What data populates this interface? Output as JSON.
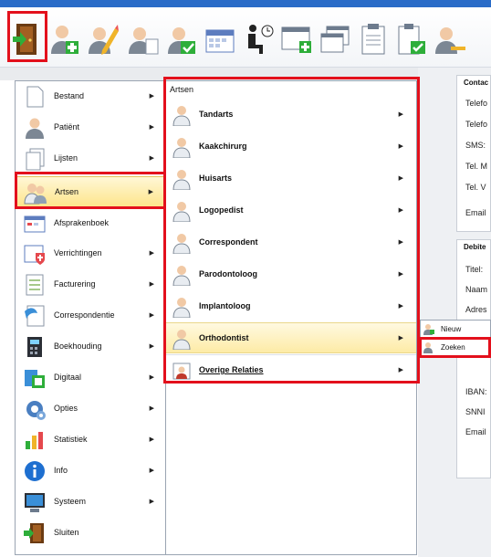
{
  "toolbar": {
    "buttons": [
      {
        "icon": "exit-door-icon"
      },
      {
        "icon": "add-patient-icon"
      },
      {
        "icon": "edit-patient-icon"
      },
      {
        "icon": "patient-list-icon"
      },
      {
        "icon": "patient-export-icon"
      },
      {
        "icon": "calendar-icon"
      },
      {
        "icon": "waiting-room-icon"
      },
      {
        "icon": "new-window-icon"
      },
      {
        "icon": "windows-icon"
      },
      {
        "icon": "clipboard-icon"
      },
      {
        "icon": "checklist-icon"
      },
      {
        "icon": "patient-key-icon"
      }
    ]
  },
  "main_menu": {
    "items": [
      {
        "label": "Bestand",
        "icon": "document-icon",
        "has_submenu": true
      },
      {
        "label": "Patiënt",
        "icon": "patient-icon",
        "has_submenu": true
      },
      {
        "label": "Lijsten",
        "icon": "lists-icon",
        "has_submenu": true
      },
      {
        "label": "Artsen",
        "icon": "doctors-icon",
        "has_submenu": true,
        "active": true
      },
      {
        "label": "Afsprakenboek",
        "icon": "appointment-book-icon",
        "has_submenu": false
      },
      {
        "label": "Verrichtingen",
        "icon": "treatments-icon",
        "has_submenu": true
      },
      {
        "label": "Facturering",
        "icon": "invoicing-icon",
        "has_submenu": true
      },
      {
        "label": "Correspondentie",
        "icon": "correspondence-icon",
        "has_submenu": true
      },
      {
        "label": "Boekhouding",
        "icon": "accounting-icon",
        "has_submenu": true
      },
      {
        "label": "Digitaal",
        "icon": "digital-icon",
        "has_submenu": true
      },
      {
        "label": "Opties",
        "icon": "options-icon",
        "has_submenu": true
      },
      {
        "label": "Statistiek",
        "icon": "statistics-icon",
        "has_submenu": true
      },
      {
        "label": "Info",
        "icon": "info-icon",
        "has_submenu": true
      },
      {
        "label": "Systeem",
        "icon": "system-icon",
        "has_submenu": true
      },
      {
        "label": "Sluiten",
        "icon": "close-door-icon",
        "has_submenu": false
      }
    ]
  },
  "sub_menu": {
    "header": "Artsen",
    "items": [
      {
        "label": "Tandarts",
        "icon": "dentist-icon"
      },
      {
        "label": "Kaakchirurg",
        "icon": "surgeon-icon"
      },
      {
        "label": "Huisarts",
        "icon": "gp-icon"
      },
      {
        "label": "Logopedist",
        "icon": "speech-therapist-icon"
      },
      {
        "label": "Correspondent",
        "icon": "correspondent-icon"
      },
      {
        "label": "Parodontoloog",
        "icon": "periodontist-icon"
      },
      {
        "label": "Implantoloog",
        "icon": "implantologist-icon"
      },
      {
        "label": "Orthodontist",
        "icon": "orthodontist-icon",
        "active": true
      },
      {
        "label": "Overige Relaties",
        "icon": "other-relations-icon"
      }
    ]
  },
  "third_menu": {
    "items": [
      {
        "label": "Nieuw",
        "icon": "new-doctor-icon"
      },
      {
        "label": "Zoeken",
        "icon": "search-doctor-icon"
      }
    ]
  },
  "background_form": {
    "sections": [
      {
        "title": "Contac",
        "fields": [
          "Telefo",
          "Telefo",
          "SMS:",
          "Tel. M",
          "Tel. V",
          "Email"
        ]
      },
      {
        "title": "Debite",
        "fields": [
          "Titel:",
          "Naam",
          "Adres"
        ]
      },
      {
        "title": "",
        "fields": [
          "IBAN:",
          "SNNI",
          "Email"
        ]
      }
    ]
  },
  "colors": {
    "highlight": "#e3101c",
    "top_strip": "#2a6cc8",
    "active_item": "#fde58b"
  }
}
